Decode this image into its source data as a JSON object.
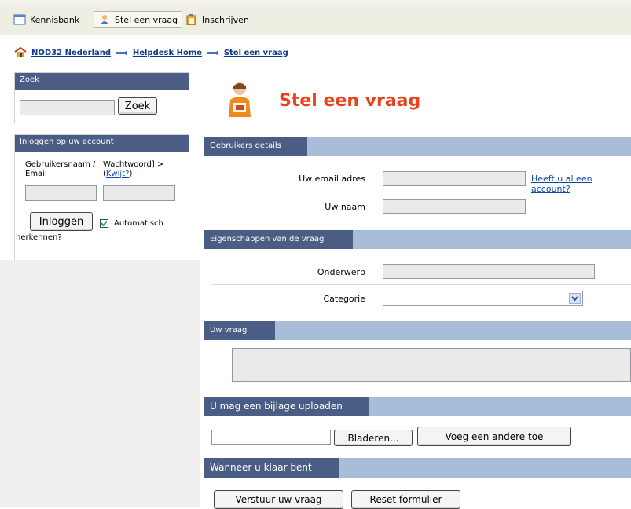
{
  "toolbar": {
    "tabs": [
      {
        "label": "Kennisbank",
        "icon": "window-icon"
      },
      {
        "label": "Stel een vraag",
        "icon": "person-icon"
      },
      {
        "label": "Inschrijven",
        "icon": "clipboard-icon"
      }
    ]
  },
  "breadcrumb": [
    "NOD32 Nederland",
    "Helpdesk Home",
    "Stel een vraag"
  ],
  "search": {
    "title": "Zoek",
    "button": "Zoek",
    "value": ""
  },
  "login": {
    "title": "Inloggen op uw account",
    "username_label": "Gebruikersnaam / Email",
    "password_label": "Wachtwoord] >",
    "forgot_prefix": "(",
    "forgot_link": "Kwijt?",
    "forgot_suffix": ")",
    "button": "Inloggen",
    "remember_label": "Automatisch",
    "remember_label2": "herkennen?",
    "remember_checked": true
  },
  "page": {
    "title": "Stel een vraag"
  },
  "sections": {
    "user": "Gebruikers details",
    "props": "Eigenschappen van de vraag",
    "question": "Uw vraag",
    "upload": "U mag een bijlage uploaden",
    "finish": "Wanneer u klaar bent"
  },
  "fields": {
    "email": "Uw email adres",
    "name": "Uw naam",
    "subject": "Onderwerp",
    "category": "Categorie",
    "has_account": "Heeft u al een account?"
  },
  "buttons": {
    "browse": "Bladeren...",
    "add_another": "Voeg een andere toe",
    "submit": "Verstuur uw vraag",
    "reset": "Reset formulier"
  },
  "colors": {
    "accent": "#e8431b",
    "section_header": "#4a5d84",
    "section_bar": "#a8bed8"
  }
}
